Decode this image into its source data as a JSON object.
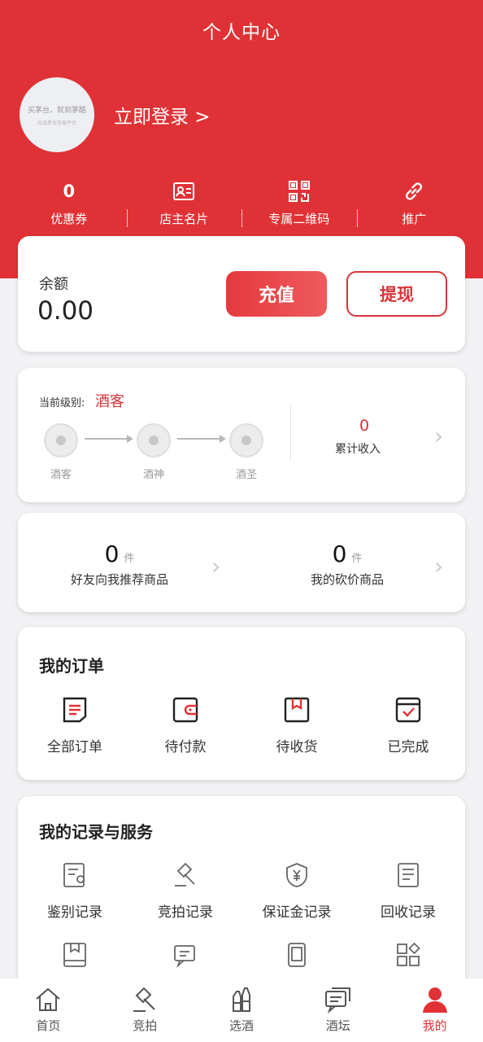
{
  "header": {
    "title": "个人中心",
    "avatar_line1": "买茅台，就到茅酷",
    "avatar_line2": "珍品茅台交易平台",
    "login_label": "立即登录 >",
    "stats": [
      {
        "value": "0",
        "label": "优惠券"
      },
      {
        "icon": "business-card-icon",
        "label": "店主名片"
      },
      {
        "icon": "qr-code-icon",
        "label": "专属二维码"
      },
      {
        "icon": "link-icon",
        "label": "推广"
      }
    ]
  },
  "balance": {
    "label": "余额",
    "value": "0.00",
    "recharge_label": "充值",
    "withdraw_label": "提现"
  },
  "level": {
    "current_label": "当前级别:",
    "current_value": "酒客",
    "steps": [
      "酒客",
      "酒神",
      "酒圣"
    ],
    "income_value": "0",
    "income_label": "累计收入"
  },
  "recommend": {
    "items": [
      {
        "count": "0",
        "unit": "件",
        "label": "好友向我推荐商品"
      },
      {
        "count": "0",
        "unit": "件",
        "label": "我的砍价商品"
      }
    ]
  },
  "orders": {
    "title": "我的订单",
    "items": [
      {
        "label": "全部订单",
        "icon": "all-orders-icon"
      },
      {
        "label": "待付款",
        "icon": "wallet-icon"
      },
      {
        "label": "待收货",
        "icon": "package-icon"
      },
      {
        "label": "已完成",
        "icon": "calendar-check-icon"
      }
    ]
  },
  "services": {
    "title": "我的记录与服务",
    "items": [
      {
        "label": "鉴别记录",
        "icon": "appraisal-icon"
      },
      {
        "label": "竞拍记录",
        "icon": "auction-hammer-icon"
      },
      {
        "label": "保证金记录",
        "icon": "deposit-shield-icon"
      },
      {
        "label": "回收记录",
        "icon": "recycle-list-icon"
      }
    ]
  },
  "tabbar": {
    "items": [
      {
        "label": "首页",
        "icon": "home-icon"
      },
      {
        "label": "竞拍",
        "icon": "hammer-icon"
      },
      {
        "label": "选酒",
        "icon": "bottles-icon"
      },
      {
        "label": "酒坛",
        "icon": "chat-icon"
      },
      {
        "label": "我的",
        "icon": "user-icon",
        "active": true
      }
    ]
  },
  "colors": {
    "brand_red": "#e03236",
    "background": "#f2f2f4"
  }
}
